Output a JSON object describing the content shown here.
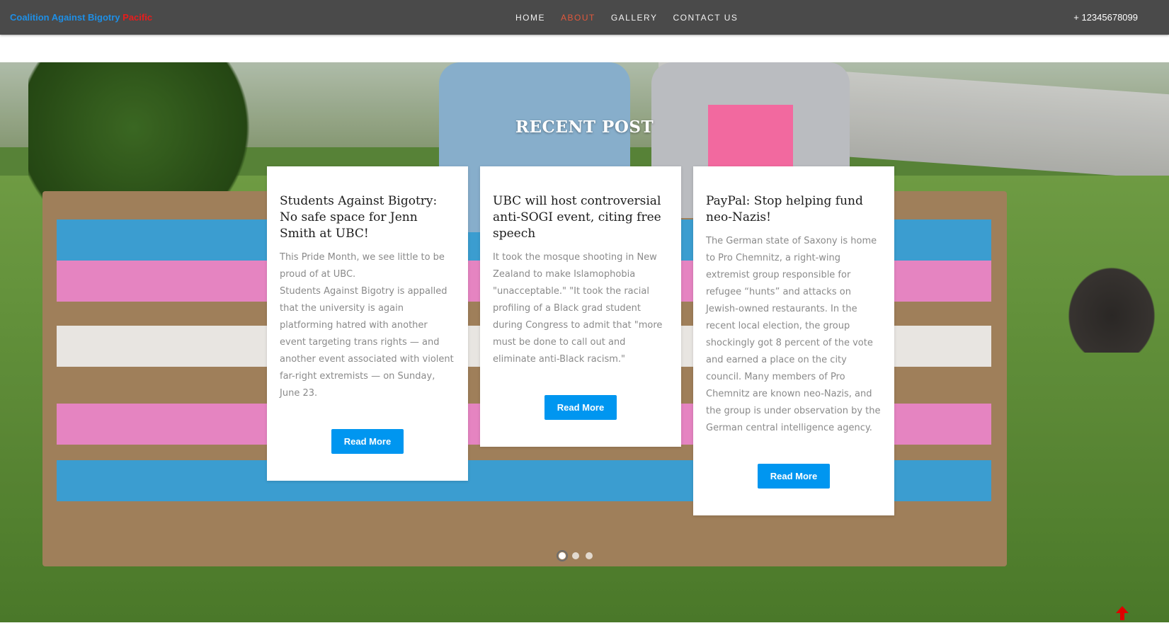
{
  "brand": {
    "part1": "Coalition Against Bigotry",
    "part2": "Pacific"
  },
  "nav": [
    {
      "label": "HOME",
      "active": false
    },
    {
      "label": "ABOUT",
      "active": true
    },
    {
      "label": "GALLERY",
      "active": false
    },
    {
      "label": "CONTACT US",
      "active": false
    }
  ],
  "phone": "+ 12345678099",
  "section_title": "RECENT POST",
  "posts": [
    {
      "title": "Students Against Bigotry: No safe space for Jenn Smith at UBC!",
      "body": "This Pride Month, we see little to be proud of at UBC.\nStudents Against Bigotry is appalled that the university is again platforming hatred with another event targeting trans rights — and another event associated with violent far-right extremists — on Sunday, June 23.",
      "button": "Read More"
    },
    {
      "title": "UBC will host controversial anti-SOGI event, citing free speech",
      "body": "It took the mosque shooting in New Zealand to make Islamophobia \"unacceptable.\" \"It took the racial profiling of a Black grad student during Congress to admit that \"more must be done to call out and eliminate anti-Black racism.\"",
      "button": "Read More"
    },
    {
      "title": "PayPal: Stop helping fund neo-Nazis!",
      "body": "The German state of Saxony is home to Pro Chemnitz, a right-wing extremist group responsible for refugee “hunts” and attacks on Jewish-owned restaurants. In the recent local election, the group shockingly got 8 percent of the vote and earned a place on the city council. Many members of Pro Chemnitz are known neo-Nazis, and the group is under observation by the German central intelligence agency.",
      "button": "Read More"
    }
  ],
  "carousel": {
    "slides": 3,
    "active_index": 0
  },
  "icons": {
    "scroll_top": "arrow-up-icon"
  },
  "colors": {
    "accent_blue": "#0096f0",
    "brand_blue": "#1e8fe6",
    "brand_red": "#e81c1c",
    "nav_active": "#e1583c",
    "navbar_bg": "#4a4a4a"
  }
}
